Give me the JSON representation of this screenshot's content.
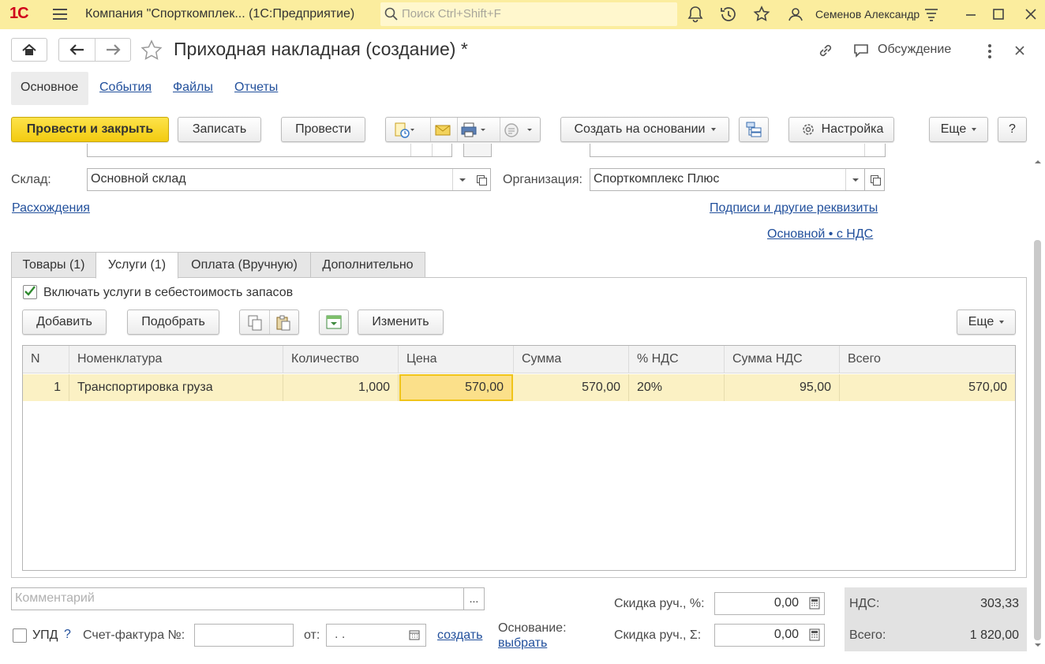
{
  "app": {
    "logo": "1С",
    "title": "Компания \"Спорткомплек...  (1С:Предприятие)",
    "search_placeholder": "Поиск Ctrl+Shift+F",
    "user": "Семенов Александр"
  },
  "form": {
    "title": "Приходная накладная (создание) *",
    "discuss_label": "Обсуждение"
  },
  "sections": [
    {
      "label": "Основное"
    },
    {
      "label": "События"
    },
    {
      "label": "Файлы"
    },
    {
      "label": "Отчеты"
    }
  ],
  "toolbar": {
    "post_close": "Провести и закрыть",
    "save": "Записать",
    "post": "Провести",
    "create_based": "Создать на основании",
    "settings": "Настройка",
    "more": "Еще",
    "help": "?"
  },
  "fields": {
    "warehouse_label": "Склад:",
    "warehouse_value": "Основной склад",
    "org_label": "Организация:",
    "org_value": "Спорткомплекс Плюс",
    "discrepancies_link": "Расхождения",
    "signatures_link": "Подписи и другие реквизиты",
    "tax_link": "Основной • с НДС"
  },
  "tabs": [
    {
      "label": "Товары (1)"
    },
    {
      "label": "Услуги (1)"
    },
    {
      "label": "Оплата (Вручную)"
    },
    {
      "label": "Дополнительно"
    }
  ],
  "services": {
    "include_cost_label": "Включать услуги в себестоимость запасов",
    "include_cost_checked": true,
    "add_btn": "Добавить",
    "pick_btn": "Подобрать",
    "change_btn": "Изменить",
    "more_btn": "Еще",
    "columns": [
      "N",
      "Номенклатура",
      "Количество",
      "Цена",
      "Сумма",
      "% НДС",
      "Сумма НДС",
      "Всего"
    ],
    "rows": [
      {
        "n": "1",
        "item": "Транспортировка груза",
        "qty": "1,000",
        "price": "570,00",
        "sum": "570,00",
        "vat_rate": "20%",
        "vat_sum": "95,00",
        "total": "570,00"
      }
    ]
  },
  "footer": {
    "comment_placeholder": "Комментарий",
    "comment_btn": "...",
    "upd_label": "УПД",
    "upd_help": "?",
    "invoice_label": "Счет-фактура №:",
    "invoice_value": "",
    "from_label": "от:",
    "date_value": " .  .",
    "create_link": "создать",
    "basis_label": "Основание:",
    "basis_link": "выбрать",
    "discount_pct_label": "Скидка руч., %:",
    "discount_pct_value": "0,00",
    "discount_sum_label": "Скидка руч., Σ:",
    "discount_sum_value": "0,00",
    "vat_label": "НДС:",
    "vat_value": "303,33",
    "total_label": "Всего:",
    "total_value": "1 820,00"
  }
}
